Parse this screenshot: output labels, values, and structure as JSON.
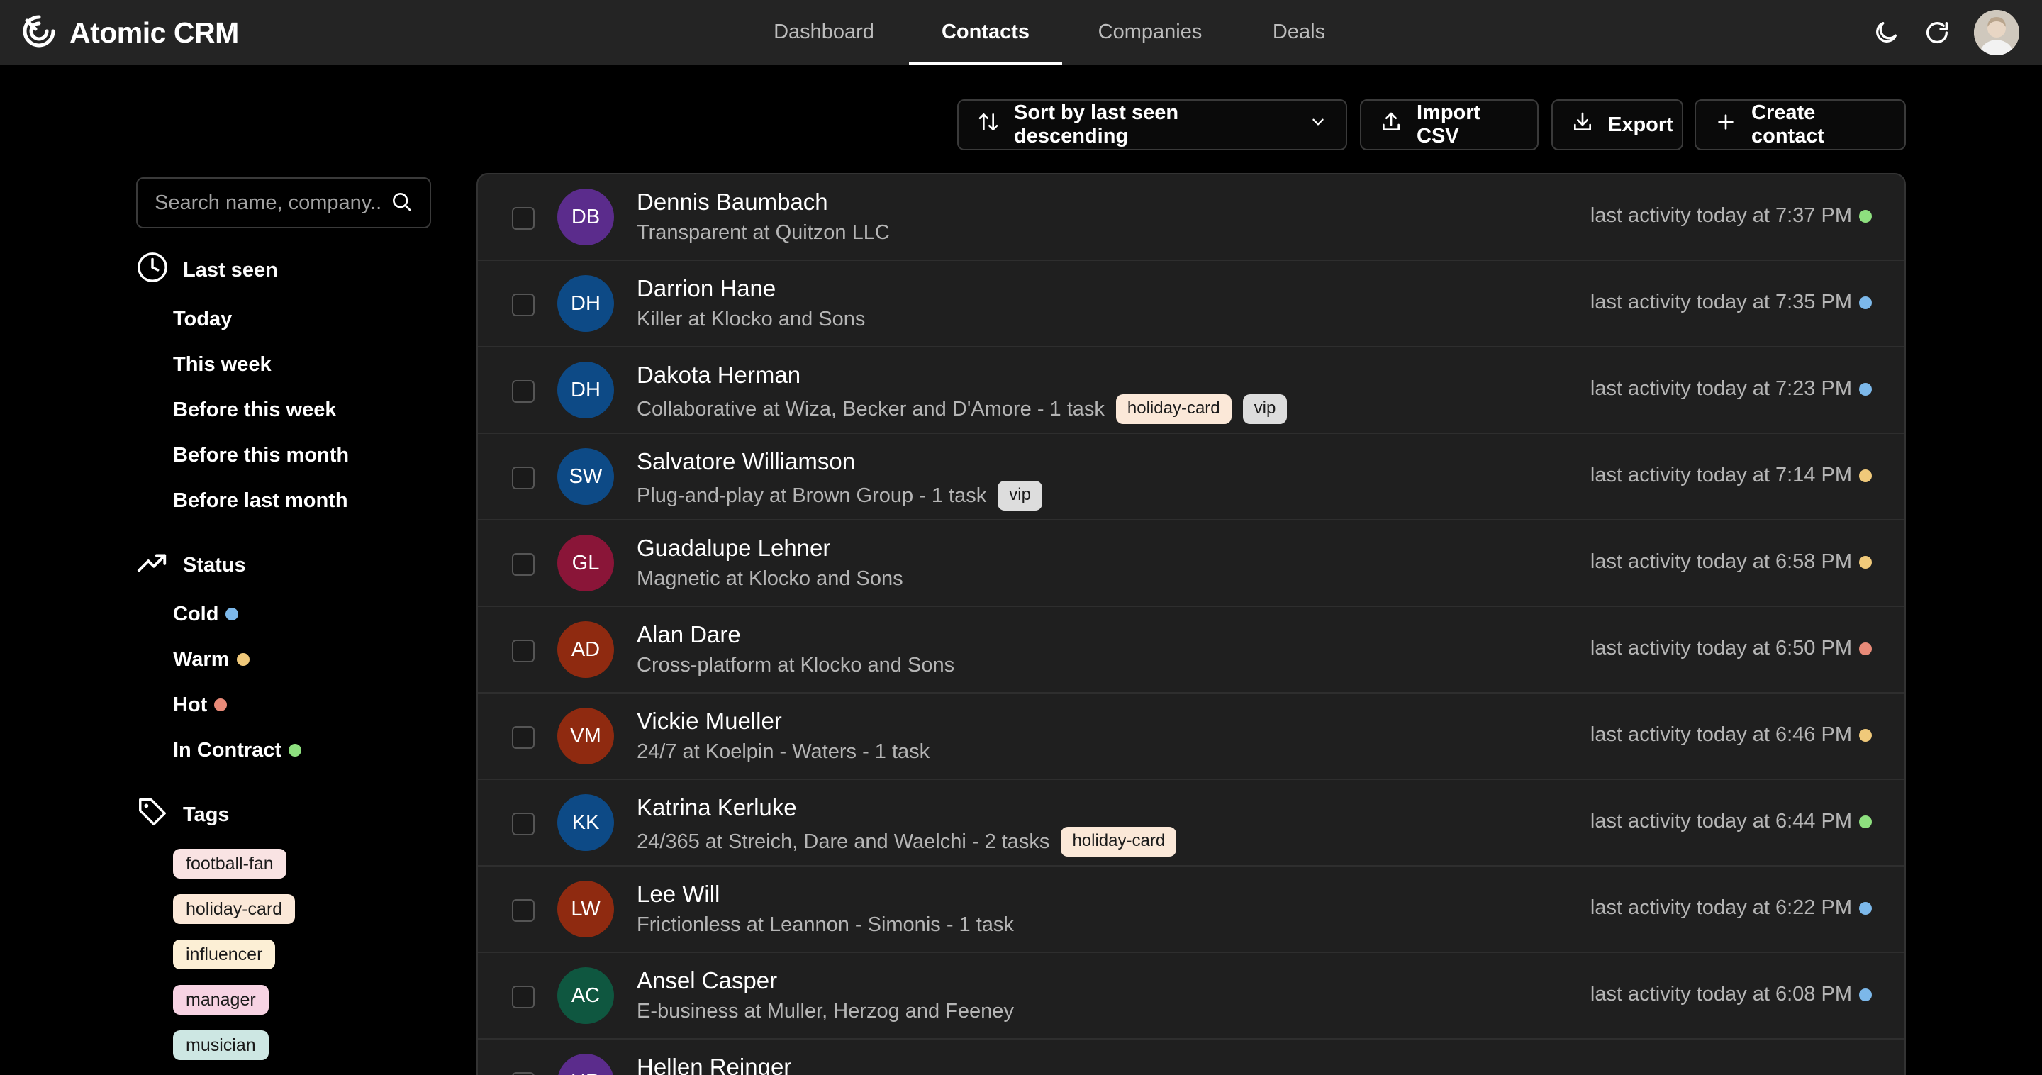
{
  "app": {
    "name": "Atomic CRM"
  },
  "nav": {
    "tabs": [
      {
        "label": "Dashboard"
      },
      {
        "label": "Contacts"
      },
      {
        "label": "Companies"
      },
      {
        "label": "Deals"
      }
    ]
  },
  "toolbar": {
    "sort_label": "Sort by last seen descending",
    "import_label": "Import CSV",
    "export_label": "Export",
    "create_label": "Create contact"
  },
  "search": {
    "placeholder": "Search name, company.."
  },
  "sidebar": {
    "last_seen": {
      "title": "Last seen",
      "items": [
        "Today",
        "This week",
        "Before this week",
        "Before this month",
        "Before last month"
      ]
    },
    "status": {
      "title": "Status",
      "items": [
        {
          "label": "Cold",
          "color": "#7cb8ea"
        },
        {
          "label": "Warm",
          "color": "#f0c97a"
        },
        {
          "label": "Hot",
          "color": "#e88a78"
        },
        {
          "label": "In Contract",
          "color": "#8ee07f"
        }
      ]
    },
    "tags": {
      "title": "Tags",
      "items": [
        {
          "label": "football-fan",
          "color": "#f9e3e3"
        },
        {
          "label": "holiday-card",
          "color": "#fbe8d8"
        },
        {
          "label": "influencer",
          "color": "#fcefd5"
        },
        {
          "label": "manager",
          "color": "#f7d3e3"
        },
        {
          "label": "musician",
          "color": "#cde7e3"
        }
      ]
    }
  },
  "contacts": [
    {
      "initials": "DB",
      "avatar_color": "#5b2c8c",
      "name": "Dennis Baumbach",
      "subtitle": "Transparent at Quitzon LLC",
      "tags": [],
      "activity": "last activity today at 7:37 PM",
      "status_color": "#8ee07f"
    },
    {
      "initials": "DH",
      "avatar_color": "#0d4a86",
      "name": "Darrion Hane",
      "subtitle": "Killer at Klocko and Sons",
      "tags": [],
      "activity": "last activity today at 7:35 PM",
      "status_color": "#7cb8ea"
    },
    {
      "initials": "DH",
      "avatar_color": "#0d4a86",
      "name": "Dakota Herman",
      "subtitle": "Collaborative at Wiza, Becker and D'Amore - 1 task",
      "tags": [
        {
          "label": "holiday-card",
          "color": "#fbe8d8"
        },
        {
          "label": "vip",
          "color": "#dddddd"
        }
      ],
      "activity": "last activity today at 7:23 PM",
      "status_color": "#7cb8ea"
    },
    {
      "initials": "SW",
      "avatar_color": "#0d4a86",
      "name": "Salvatore Williamson",
      "subtitle": "Plug-and-play at Brown Group - 1 task",
      "tags": [
        {
          "label": "vip",
          "color": "#dddddd"
        }
      ],
      "activity": "last activity today at 7:14 PM",
      "status_color": "#f0c97a"
    },
    {
      "initials": "GL",
      "avatar_color": "#8a1538",
      "name": "Guadalupe Lehner",
      "subtitle": "Magnetic at Klocko and Sons",
      "tags": [],
      "activity": "last activity today at 6:58 PM",
      "status_color": "#f0c97a"
    },
    {
      "initials": "AD",
      "avatar_color": "#8f2a10",
      "name": "Alan Dare",
      "subtitle": "Cross-platform at Klocko and Sons",
      "tags": [],
      "activity": "last activity today at 6:50 PM",
      "status_color": "#e88a78"
    },
    {
      "initials": "VM",
      "avatar_color": "#8f2a10",
      "name": "Vickie Mueller",
      "subtitle": "24/7 at Koelpin - Waters - 1 task",
      "tags": [],
      "activity": "last activity today at 6:46 PM",
      "status_color": "#f0c97a"
    },
    {
      "initials": "KK",
      "avatar_color": "#0d4a86",
      "name": "Katrina Kerluke",
      "subtitle": "24/365 at Streich, Dare and Waelchi - 2 tasks",
      "tags": [
        {
          "label": "holiday-card",
          "color": "#fbe8d8"
        }
      ],
      "activity": "last activity today at 6:44 PM",
      "status_color": "#8ee07f"
    },
    {
      "initials": "LW",
      "avatar_color": "#8f2a10",
      "name": "Lee Will",
      "subtitle": "Frictionless at Leannon - Simonis - 1 task",
      "tags": [],
      "activity": "last activity today at 6:22 PM",
      "status_color": "#7cb8ea"
    },
    {
      "initials": "AC",
      "avatar_color": "#0f5740",
      "name": "Ansel Casper",
      "subtitle": "E-business at Muller, Herzog and Feeney",
      "tags": [],
      "activity": "last activity today at 6:08 PM",
      "status_color": "#7cb8ea"
    },
    {
      "initials": "HR",
      "avatar_color": "#5b2c8c",
      "name": "Hellen Reinger",
      "subtitle": "",
      "tags": [],
      "activity": "",
      "status_color": "#7cb8ea"
    }
  ]
}
